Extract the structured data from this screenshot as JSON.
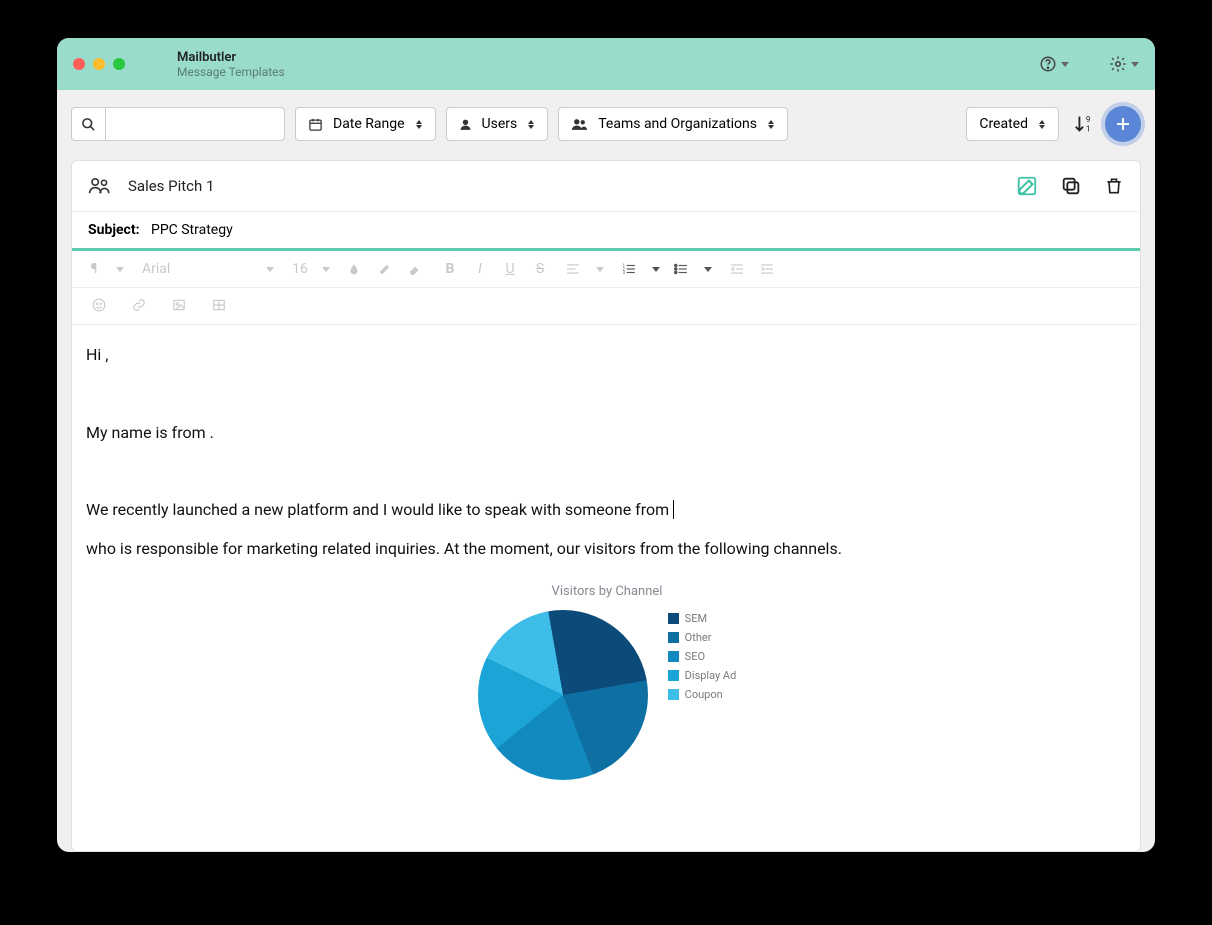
{
  "header": {
    "app_title": "Mailbutler",
    "subtitle": "Message Templates"
  },
  "filters": {
    "date_range_label": "Date Range",
    "users_label": "Users",
    "teams_label": "Teams and Organizations",
    "sort_label": "Created"
  },
  "template": {
    "name": "Sales Pitch 1",
    "subject_label": "Subject:",
    "subject_value": "PPC Strategy"
  },
  "editor_toolbar": {
    "font_name": "Arial",
    "font_size": "16"
  },
  "body": {
    "p1": "Hi ,",
    "p2": "My name is  from .",
    "p3a": "We recently launched a new platform and I would like to speak with someone from",
    "p3b": "who is responsible for marketing related inquiries. At the moment, our visitors from the following channels."
  },
  "chart_data": {
    "type": "pie",
    "title": "Visitors by Channel",
    "series": [
      {
        "name": "SEM",
        "value": 25,
        "color": "#0c4a7a"
      },
      {
        "name": "Other",
        "value": 22,
        "color": "#0e6fa3"
      },
      {
        "name": "SEO",
        "value": 20,
        "color": "#128abf"
      },
      {
        "name": "Display Ad",
        "value": 18,
        "color": "#1ba4d6"
      },
      {
        "name": "Coupon",
        "value": 15,
        "color": "#3dbde8"
      }
    ]
  }
}
